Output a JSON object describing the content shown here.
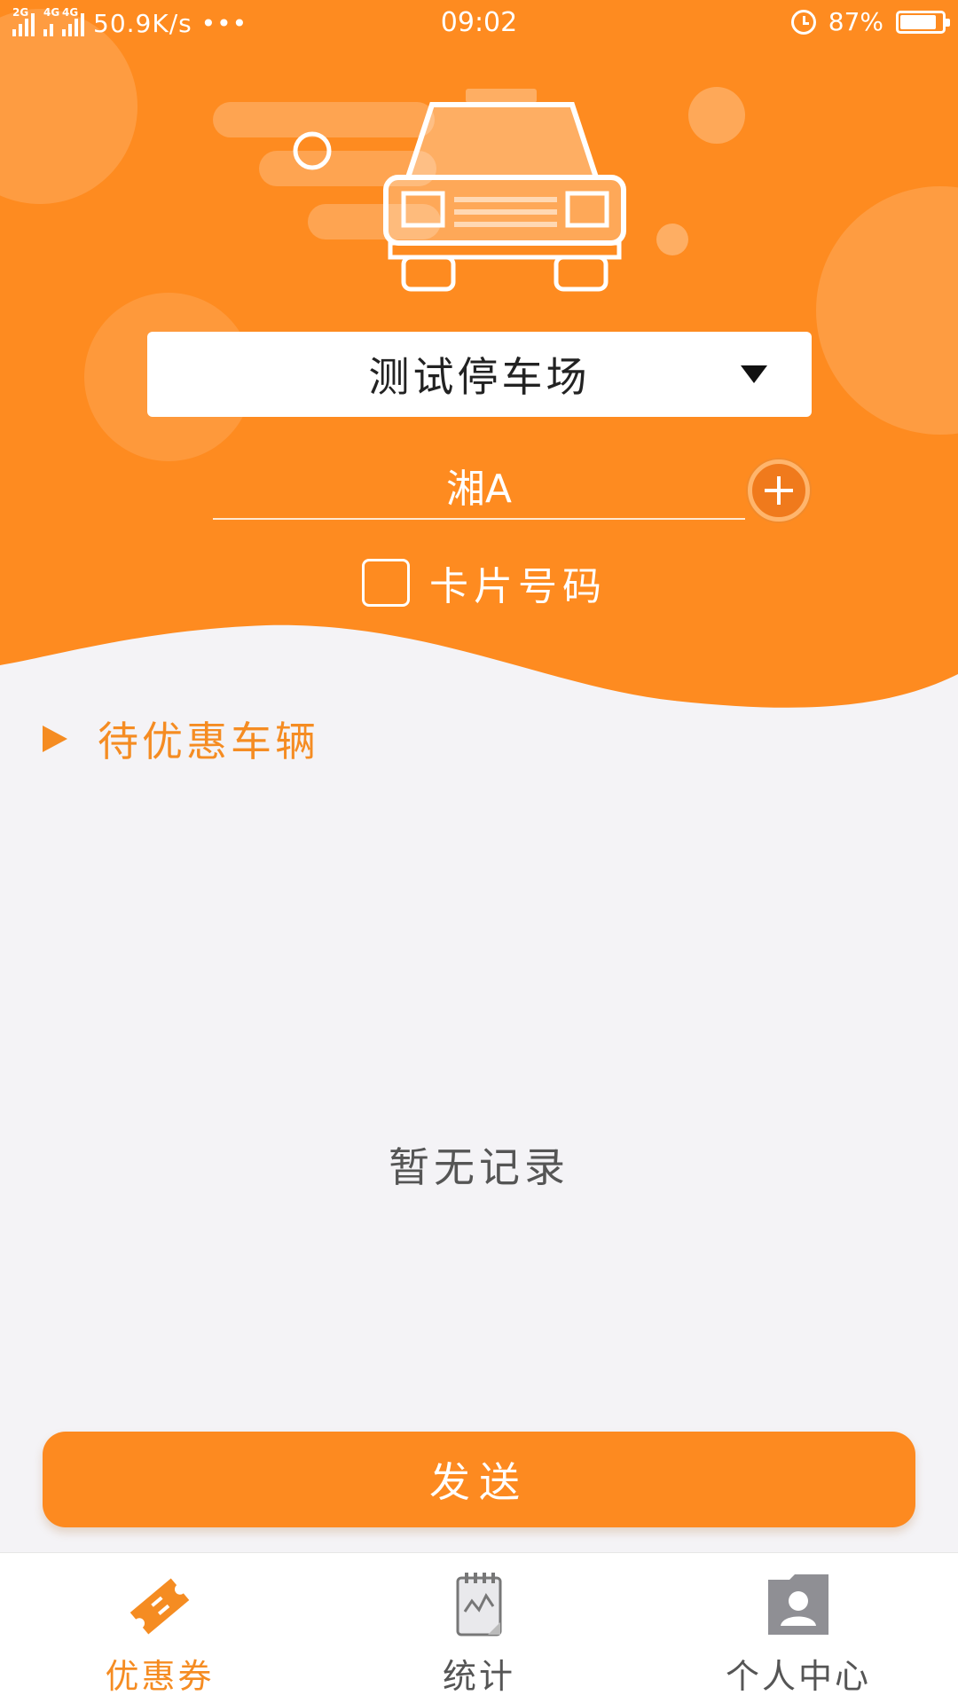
{
  "status_bar": {
    "signal_1_tag": "2G",
    "signal_2_tag": "4G",
    "signal_3_tag": "4G",
    "net_speed": "50.9K/s •••",
    "time": "09:02",
    "battery_text": "87%",
    "battery_level_percent": 87
  },
  "parking_lot": {
    "selected": "测试停车场"
  },
  "plate": {
    "value": "湘A"
  },
  "card_number": {
    "label": "卡片号码",
    "checked": false
  },
  "section": {
    "title": "待优惠车辆"
  },
  "list": {
    "empty_text": "暂无记录"
  },
  "actions": {
    "send_label": "发送"
  },
  "bottom_nav": {
    "items": [
      {
        "label": "优惠券",
        "icon": "ticket-icon",
        "active": true
      },
      {
        "label": "统计",
        "icon": "stats-icon",
        "active": false
      },
      {
        "label": "个人中心",
        "icon": "profile-icon",
        "active": false
      }
    ]
  },
  "colors": {
    "primary": "#fd8a20",
    "header": "#fe8b20",
    "accent_text": "#f58c22",
    "background": "#f4f3f6"
  }
}
